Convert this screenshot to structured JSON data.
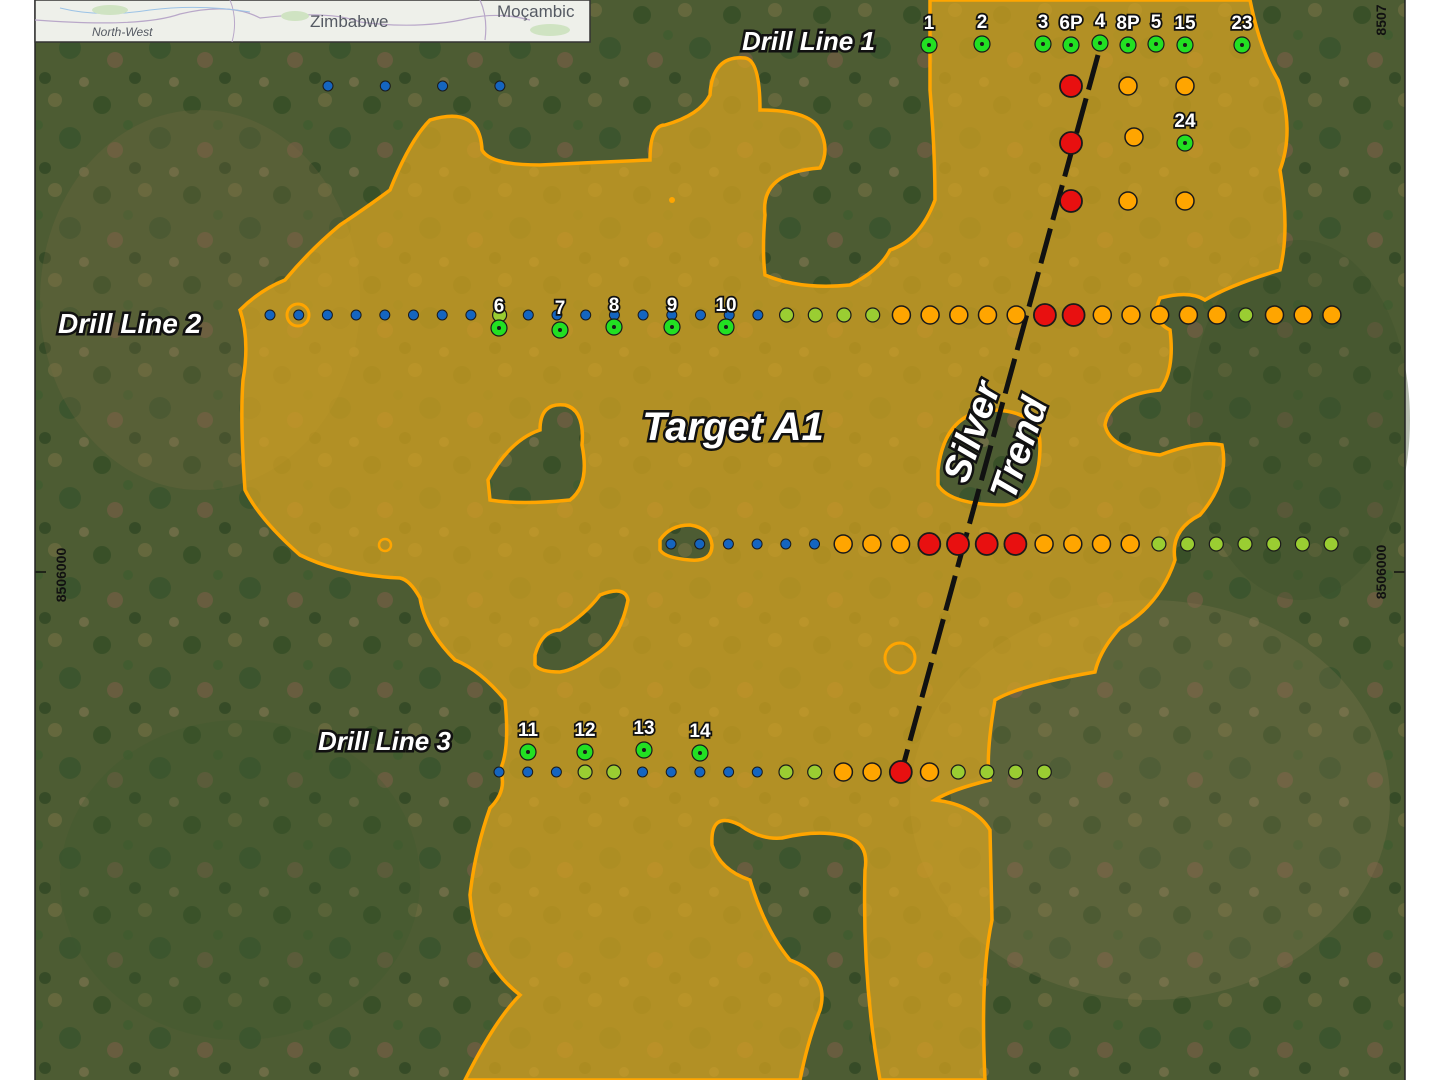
{
  "map": {
    "target_label": "Target A1",
    "trend_label_line1": "Silver",
    "trend_label_line2": "Trend",
    "drill_lines": [
      {
        "id": "dl1",
        "label": "Drill Line 1"
      },
      {
        "id": "dl2",
        "label": "Drill Line 2"
      },
      {
        "id": "dl3",
        "label": "Drill Line 3"
      }
    ],
    "hole_labels": [
      "1",
      "2",
      "3",
      "6P",
      "4",
      "8P",
      "5",
      "15",
      "23",
      "24",
      "6",
      "7",
      "8",
      "9",
      "10",
      "11",
      "12",
      "13",
      "14"
    ],
    "coordinates": {
      "left_northing": "8506000",
      "right_northing": "8506000",
      "right_top_northing": "8507"
    },
    "inset": {
      "labels": [
        "Zimbabwe",
        "Moçambic",
        "North-West"
      ]
    },
    "colors": {
      "target_fill": "#d9a520",
      "target_outline": "#ffa500",
      "drillhole": "#22e022",
      "very_low": "#1565c0",
      "low": "#9acd32",
      "medium": "#ffa500",
      "high": "#e81010",
      "trend_line": "#111111"
    }
  }
}
